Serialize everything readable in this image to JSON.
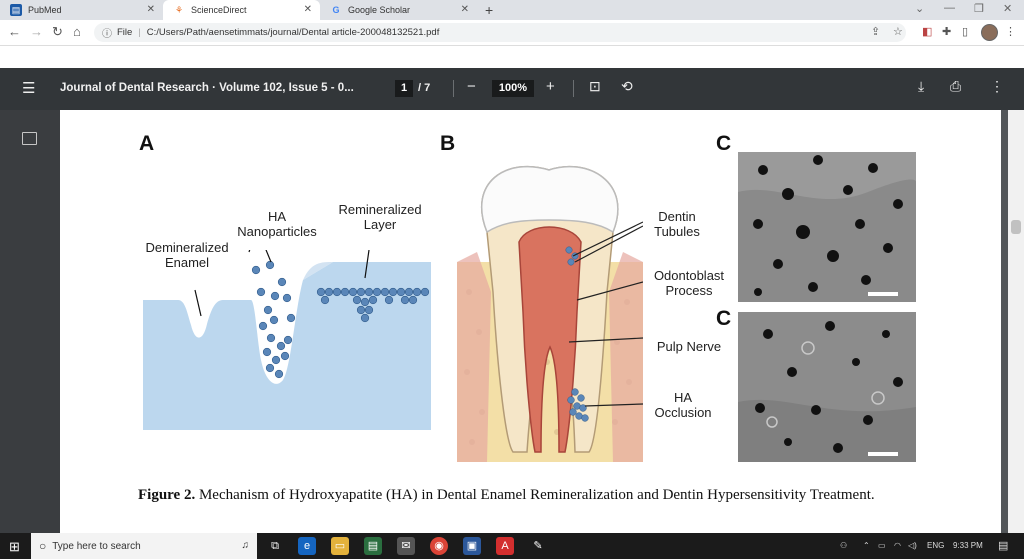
{
  "browser": {
    "tabs": [
      {
        "label": "PubMed",
        "icon": "pubmed-icon"
      },
      {
        "label": "ScienceDirect",
        "icon": "sciencedirect-icon"
      },
      {
        "label": "Google Scholar",
        "icon": "google-icon"
      }
    ],
    "address": {
      "prefix": "File",
      "url": "C:/Users/Path/aensetimmats/journal/Dental article-200048132521.pdf"
    }
  },
  "pdf": {
    "title": "Journal of Dental Research · Volume 102, Issue 5 - 0...",
    "page_current": "1",
    "page_total": "/ 7",
    "zoom": "100%"
  },
  "figure": {
    "panel_a": {
      "letter": "A",
      "label_demineralized": "Demineralized\nEnamel",
      "label_nanoparticles": "HA\nNanoparticles",
      "label_remineralized": "Remineralized\nLayer"
    },
    "panel_b": {
      "letter": "B",
      "label_tubules": "Dentin\nTubules",
      "label_odontoblast": "Odontoblast\nProcess",
      "label_pulp": "Pulp Nerve",
      "label_occlusion": "HA\nOcclusion"
    },
    "panel_c_top_letter": "C",
    "panel_c_bottom_letter": "C",
    "caption_bold": "Figure 2.",
    "caption_text": " Mechanism of Hydroxyapatite (HA) in Dental Enamel Remineralization and Dentin Hypersensitivity Treatment."
  },
  "taskbar": {
    "search_placeholder": "Type here to search",
    "lang": "ENG",
    "time": "9:33 PM"
  },
  "colors": {
    "pdf_toolbar": "#323639",
    "viewer_bg": "#525659",
    "enamel_blue": "#bcd7ee",
    "pulp_red": "#d9735f"
  }
}
